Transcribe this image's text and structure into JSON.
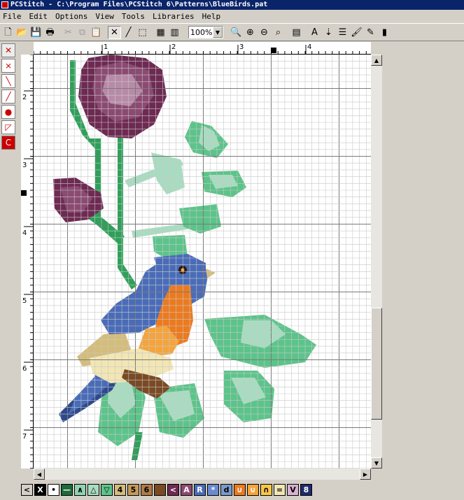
{
  "window": {
    "title": "PCStitch - C:\\Program Files\\PCStitch 6\\Patterns\\BlueBirds.pat"
  },
  "menu": [
    "File",
    "Edit",
    "Options",
    "View",
    "Tools",
    "Libraries",
    "Help"
  ],
  "toolbar": {
    "zoom_value": "100%",
    "file_tools": [
      {
        "name": "new-icon",
        "glyph": "🗋"
      },
      {
        "name": "open-folder-icon",
        "glyph": "📂"
      },
      {
        "name": "save-icon",
        "glyph": "💾"
      },
      {
        "name": "print-icon",
        "glyph": "🖶"
      }
    ],
    "edit_tools": [
      {
        "name": "cut-icon",
        "glyph": "✂"
      },
      {
        "name": "copy-icon",
        "glyph": "⧉"
      },
      {
        "name": "paste-icon",
        "glyph": "📋"
      }
    ],
    "draw_tools": [
      {
        "name": "full-stitch-icon",
        "glyph": "✕"
      },
      {
        "name": "backstitch-icon",
        "glyph": "╱"
      },
      {
        "name": "select-rect-icon",
        "glyph": "⬚"
      }
    ],
    "zoom_tools": [
      {
        "name": "zoom-icon",
        "glyph": "🔍"
      },
      {
        "name": "zoom-in-icon",
        "glyph": "⊕"
      },
      {
        "name": "zoom-out-icon",
        "glyph": "⊖"
      },
      {
        "name": "zoom-fit-icon",
        "glyph": "⌕"
      }
    ],
    "right_tools": [
      {
        "name": "text-icon",
        "glyph": "A"
      },
      {
        "name": "text-down-icon",
        "glyph": "⇣"
      },
      {
        "name": "alphabet-icon",
        "glyph": "☰"
      },
      {
        "name": "brush-icon",
        "glyph": "🖌"
      },
      {
        "name": "eyedropper-icon",
        "glyph": "✎"
      },
      {
        "name": "floss-icon",
        "glyph": "▮"
      }
    ]
  },
  "left_tools": [
    {
      "name": "full-cross-tool-icon",
      "glyph": "✕"
    },
    {
      "name": "half-cross-tool-icon",
      "glyph": "⨯"
    },
    {
      "name": "half-stitch-tool-icon",
      "glyph": "╲"
    },
    {
      "name": "quarter-stitch-tool-icon",
      "glyph": "╱"
    },
    {
      "name": "french-knot-tool-icon",
      "glyph": "●"
    },
    {
      "name": "three-quarter-tool-icon",
      "glyph": "◸"
    },
    {
      "name": "color-tool-icon",
      "glyph": "C"
    }
  ],
  "ruler": {
    "top_labels": [
      "1",
      "2",
      "3",
      "4"
    ],
    "left_labels": [
      "2",
      "3",
      "4",
      "5",
      "6",
      "7"
    ]
  },
  "pattern_colors": {
    "rose_dark": "#6e2a52",
    "rose_mid": "#8c4a72",
    "rose_light": "#b88aa8",
    "leaf_dark": "#2fa05a",
    "leaf_mid": "#5cc48a",
    "leaf_light": "#a8dcc0",
    "bird_blue": "#4a6cb8",
    "bird_blue_dark": "#2e4a8c",
    "bird_orange": "#ec7a1e",
    "bird_orange_light": "#f4a43c",
    "bird_cream": "#f2e6b4",
    "bird_tan": "#d4bc7a",
    "branch": "#7a4a24",
    "eye": "#2a1a10"
  },
  "palette": [
    {
      "sym": "<",
      "bg": "#d4d0c8",
      "fg": "#000000",
      "name": "palette-scroll-left-button"
    },
    {
      "sym": "X",
      "bg": "#000000",
      "fg": "#ffffff",
      "name": "palette-color-black"
    },
    {
      "sym": "•",
      "bg": "#ffffff",
      "fg": "#000000",
      "name": "palette-color-white"
    },
    {
      "sym": "—",
      "bg": "#1e6a3a",
      "fg": "#ffffff",
      "name": "palette-color-dark-green"
    },
    {
      "sym": "∧",
      "bg": "#8ed4b0",
      "fg": "#000000",
      "name": "palette-color-mint"
    },
    {
      "sym": "△",
      "bg": "#a8dcc0",
      "fg": "#000000",
      "name": "palette-color-light-mint"
    },
    {
      "sym": "▽",
      "bg": "#5cc48a",
      "fg": "#000000",
      "name": "palette-color-green"
    },
    {
      "sym": "4",
      "bg": "#d4bc7a",
      "fg": "#000000",
      "name": "palette-color-tan"
    },
    {
      "sym": "5",
      "bg": "#c49a5a",
      "fg": "#000000",
      "name": "palette-color-brown-light"
    },
    {
      "sym": "6",
      "bg": "#b07a46",
      "fg": "#000000",
      "name": "palette-color-brown"
    },
    {
      "sym": "",
      "bg": "#7a4a24",
      "fg": "#ffffff",
      "name": "palette-color-dark-brown"
    },
    {
      "sym": "<",
      "bg": "#6e2a52",
      "fg": "#ffffff",
      "name": "palette-color-plum"
    },
    {
      "sym": "A",
      "bg": "#8c4a72",
      "fg": "#ffffff",
      "name": "palette-color-mauve"
    },
    {
      "sym": "R",
      "bg": "#4a6cb8",
      "fg": "#ffffff",
      "name": "palette-color-blue"
    },
    {
      "sym": "*",
      "bg": "#6a8ad0",
      "fg": "#ffffff",
      "name": "palette-color-light-blue"
    },
    {
      "sym": "d",
      "bg": "#7a9ac8",
      "fg": "#000000",
      "name": "palette-color-sky"
    },
    {
      "sym": "∪",
      "bg": "#ec7a1e",
      "fg": "#ffffff",
      "name": "palette-color-orange"
    },
    {
      "sym": "∪",
      "bg": "#f4a43c",
      "fg": "#ffffff",
      "name": "palette-color-light-orange"
    },
    {
      "sym": "∩",
      "bg": "#f6c64a",
      "fg": "#000000",
      "name": "palette-color-gold"
    },
    {
      "sym": "=",
      "bg": "#f2e6b4",
      "fg": "#000000",
      "name": "palette-color-cream"
    },
    {
      "sym": "V",
      "bg": "#d8b0d0",
      "fg": "#000000",
      "name": "palette-color-pink"
    },
    {
      "sym": "8",
      "bg": "#1e2a6a",
      "fg": "#ffffff",
      "name": "palette-color-navy"
    }
  ]
}
